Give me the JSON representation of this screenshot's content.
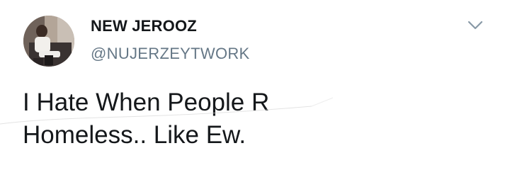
{
  "tweet": {
    "display_name": "NEW JEROOZ",
    "handle": "@NUJERZEYTWORK",
    "text_lines": [
      "I Hate When People R",
      "Homeless.. Like Ew."
    ],
    "menu_icon": "chevron-down-icon",
    "avatar_icon": "user-avatar"
  },
  "colors": {
    "text_primary": "#14171a",
    "text_secondary": "#657786",
    "background": "#ffffff"
  }
}
